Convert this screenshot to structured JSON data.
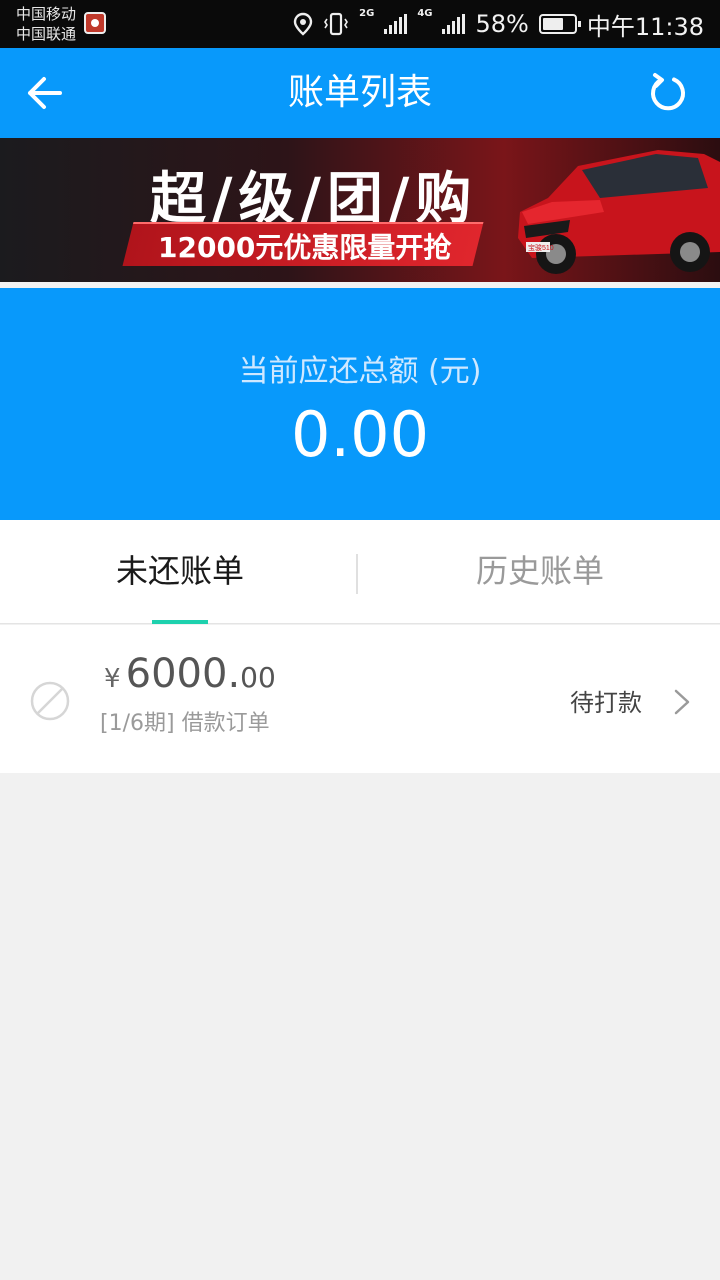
{
  "status_bar": {
    "carrier1": "中国移动",
    "carrier2": "中国联通",
    "net1": "2G",
    "net2": "4G",
    "battery": "58%",
    "time": "中午11:38",
    "icons": [
      "location-icon",
      "vibrate-icon",
      "signal-icon",
      "signal-icon",
      "battery-icon"
    ]
  },
  "header": {
    "title": "账单列表",
    "back_icon": "back-arrow-icon",
    "refresh_icon": "refresh-icon"
  },
  "banner": {
    "title": "超/级/团/购",
    "subtitle": "12000元优惠限量开抢",
    "car_badge": "宝骏510"
  },
  "summary": {
    "label": "当前应还总额 (元)",
    "amount": "0.00"
  },
  "tabs": [
    {
      "label": "未还账单",
      "active": true
    },
    {
      "label": "历史账单",
      "active": false
    }
  ],
  "bills": [
    {
      "currency": "¥",
      "amount_int": "6000.",
      "amount_dec": "00",
      "desc": "[1/6期] 借款订单",
      "status": "待打款",
      "icon": "disabled-circle-icon"
    }
  ],
  "colors": {
    "brand_blue": "#0899fb",
    "tab_indicator": "#1ed1ae",
    "background": "#f1f1f1"
  }
}
